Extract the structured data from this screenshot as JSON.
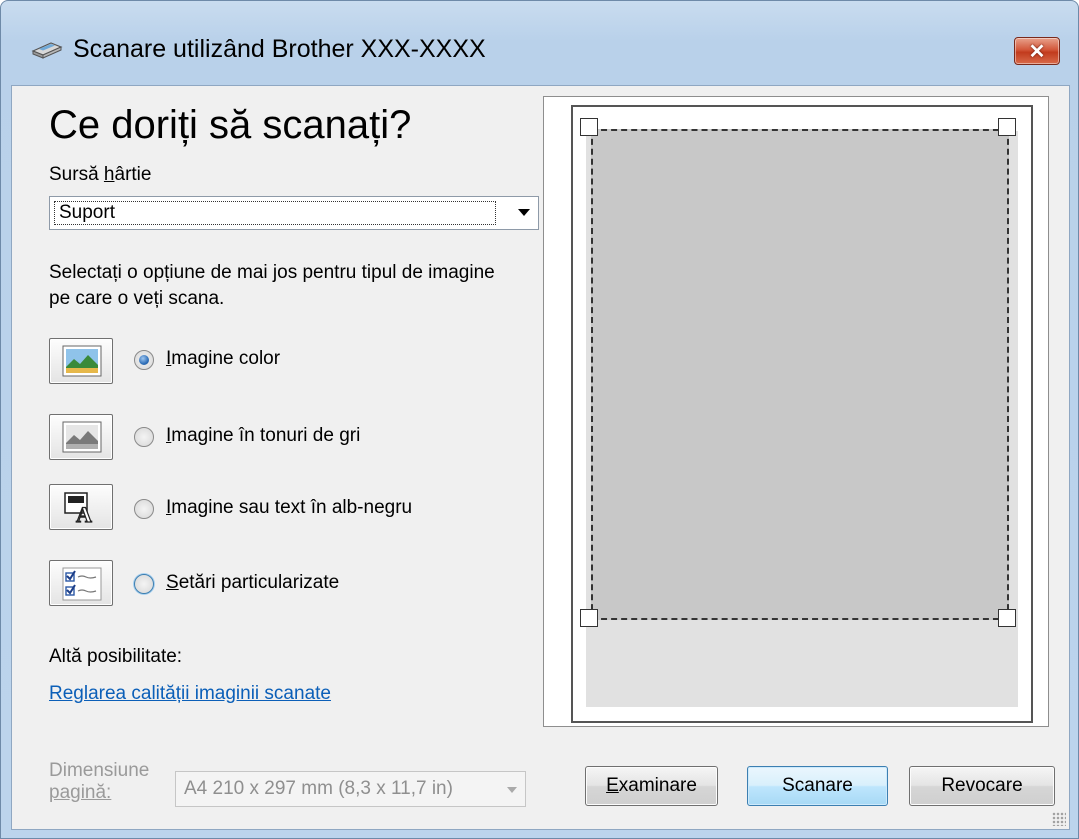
{
  "window": {
    "title": "Scanare utilizând Brother XXX-XXXX",
    "close_label": "✕"
  },
  "main": {
    "heading": "Ce doriți să scanați?",
    "paper_source": {
      "label_prefix": "Sursă ",
      "label_mnemonic": "h",
      "label_suffix": "ârtie",
      "value": "Suport"
    },
    "instruction": "Selectați o opțiune de mai jos pentru tipul de imagine pe care o veți scana.",
    "options": [
      {
        "mnemonic": "I",
        "rest": "magine color",
        "selected": true,
        "icon": "color-photo-icon"
      },
      {
        "mnemonic": "I",
        "rest": "magine în tonuri de gri",
        "selected": false,
        "icon": "grayscale-photo-icon"
      },
      {
        "mnemonic": "I",
        "rest": "magine sau text în alb-negru",
        "selected": false,
        "icon": "black-white-text-icon"
      },
      {
        "mnemonic": "S",
        "rest": "etări particularizate",
        "selected": false,
        "icon": "custom-settings-icon"
      }
    ],
    "other_label": "Altă posibilitate:",
    "quality_link": "Reglarea calității imaginii scanate"
  },
  "footer": {
    "page_size_label_line1": "Dimensiune",
    "page_size_label_line2": "pagină:",
    "page_size_value": "A4 210 x 297 mm (8,3 x 11,7 in)",
    "buttons": {
      "preview": {
        "mnemonic": "E",
        "rest": "xaminare"
      },
      "scan": "Scanare",
      "cancel": "Revocare"
    }
  },
  "colors": {
    "accent": "#3c7fb1",
    "link": "#0b5fb8",
    "close": "#c23b1d"
  }
}
